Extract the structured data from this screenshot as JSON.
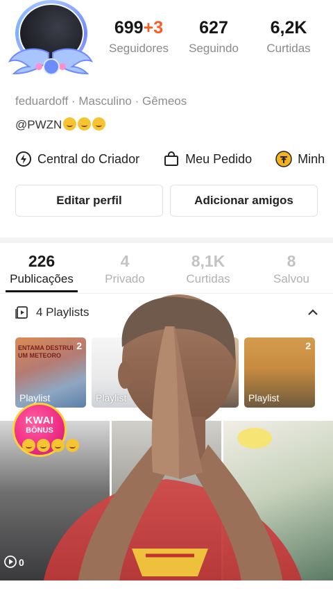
{
  "profile": {
    "stats": [
      {
        "value": "699",
        "plus": "+3",
        "label": "Seguidores"
      },
      {
        "value": "627",
        "plus": "",
        "label": "Seguindo"
      },
      {
        "value": "6,2K",
        "plus": "",
        "label": "Curtidas"
      }
    ],
    "bio_line": "feduardoff · Masculino · Gêmeos",
    "handle": "@PWZN"
  },
  "shortcuts": [
    {
      "label": "Central do Criador",
      "icon": "lightning-circle-icon"
    },
    {
      "label": "Meu Pedido",
      "icon": "shopping-bag-icon"
    },
    {
      "label": "Minh",
      "icon": "coin-icon"
    }
  ],
  "buttons": {
    "edit": "Editar perfil",
    "add_friends": "Adicionar amigos"
  },
  "tabs": [
    {
      "count": "226",
      "label": "Publicações"
    },
    {
      "count": "4",
      "label": "Privado"
    },
    {
      "count": "8,1K",
      "label": "Curtidas"
    },
    {
      "count": "8",
      "label": "Salvou"
    }
  ],
  "playlists": {
    "title": "4 Playlists",
    "cards": [
      {
        "count": "2",
        "label": "Playlist",
        "caption": "ENTAMA DESTRUI UM METEORO"
      },
      {
        "count": "",
        "label": "Playlist",
        "caption": ""
      },
      {
        "count": "",
        "label": "",
        "caption": ""
      },
      {
        "count": "2",
        "label": "Playlist",
        "caption": ""
      }
    ]
  },
  "kwai_badge": {
    "line1": "KWAI",
    "line2": "BÔNUS"
  },
  "videos": [
    {
      "views": "0"
    },
    {
      "views": ""
    },
    {
      "views": ""
    }
  ],
  "colors": {
    "accent_plus": "#ff5a1f",
    "kwai_pink": "#f02f86",
    "kwai_gold": "#ffd23a"
  }
}
